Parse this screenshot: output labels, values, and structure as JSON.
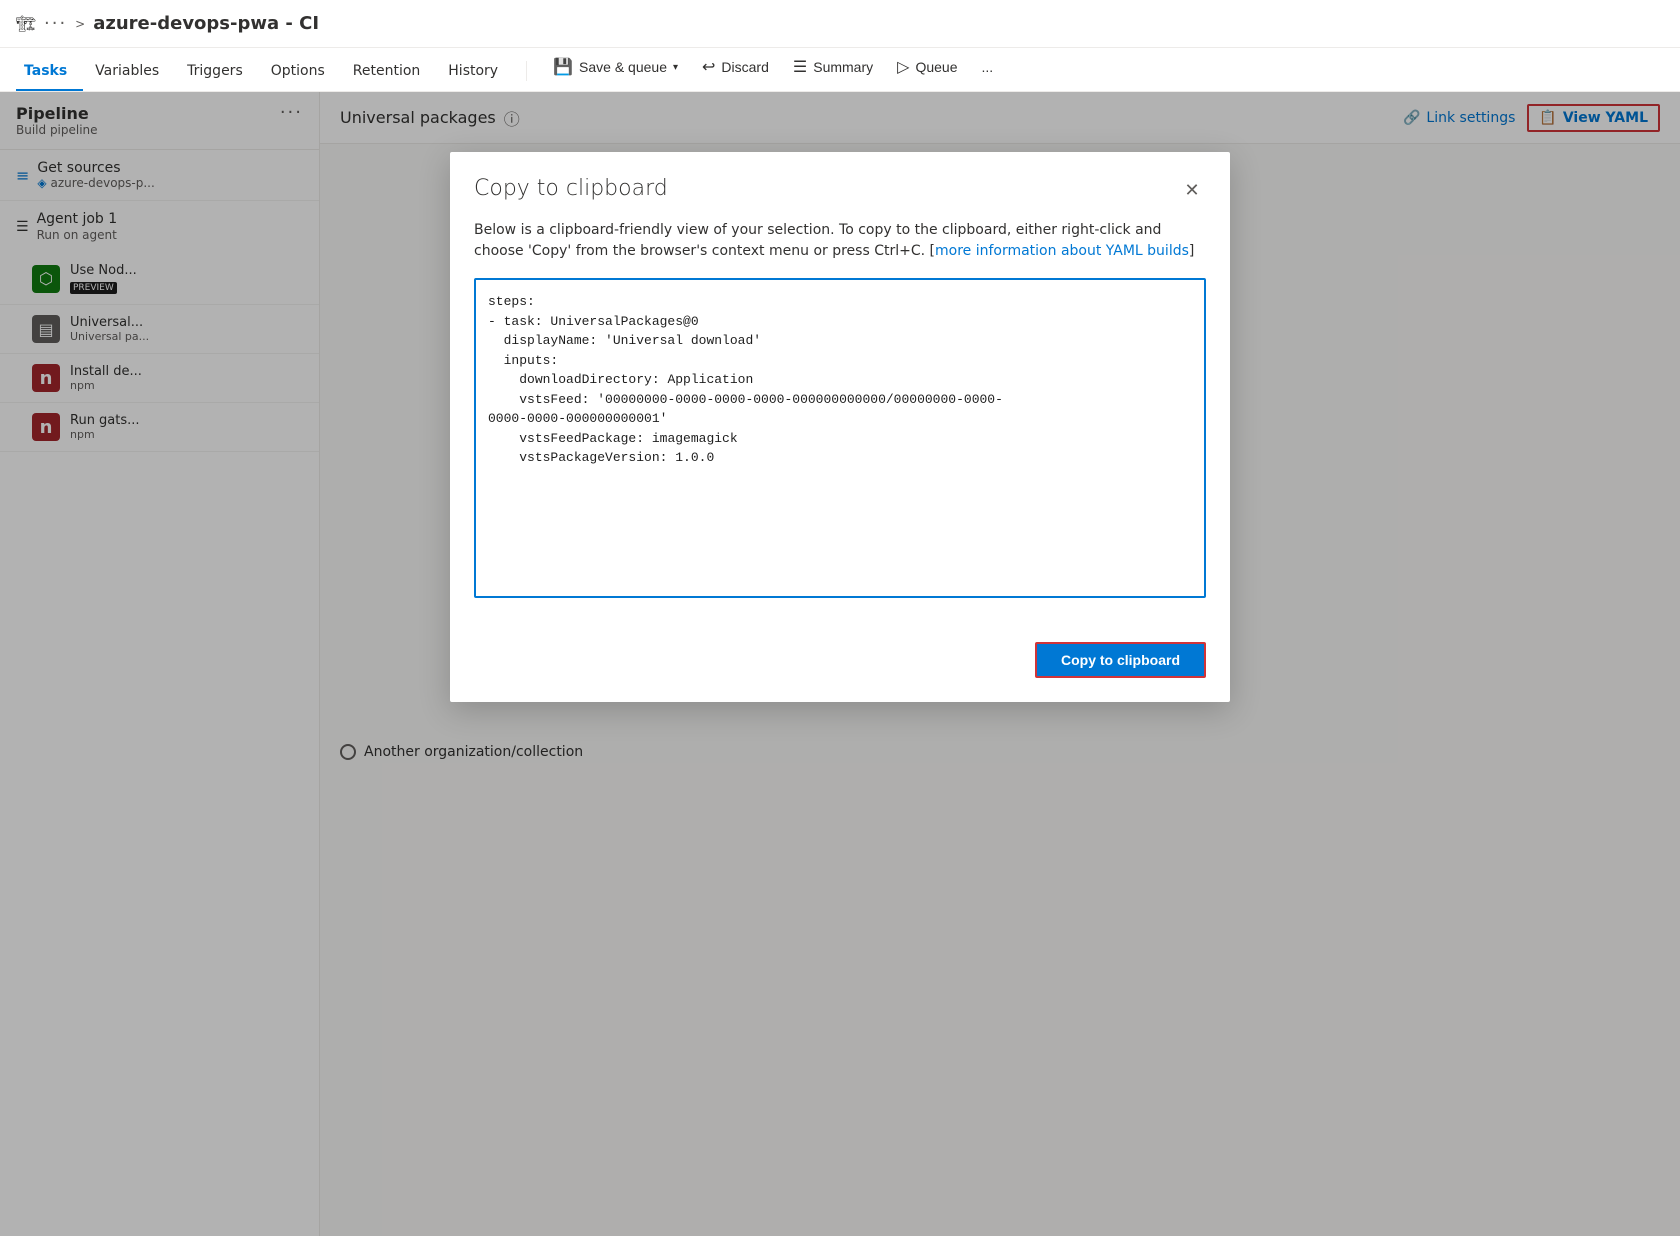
{
  "app": {
    "icon": "🏗",
    "breadcrumb_dots": "···",
    "breadcrumb_sep": ">",
    "page_title": "azure-devops-pwa - CI"
  },
  "nav": {
    "tabs": [
      {
        "label": "Tasks",
        "active": true
      },
      {
        "label": "Variables",
        "active": false
      },
      {
        "label": "Triggers",
        "active": false
      },
      {
        "label": "Options",
        "active": false
      },
      {
        "label": "Retention",
        "active": false
      },
      {
        "label": "History",
        "active": false
      }
    ],
    "actions": {
      "save_queue": "Save & queue",
      "discard": "Discard",
      "summary": "Summary",
      "queue": "Queue",
      "more": "..."
    }
  },
  "left_panel": {
    "pipeline_label": "Pipeline",
    "pipeline_sub": "Build pipeline",
    "three_dots": "···",
    "get_sources_label": "Get sources",
    "get_sources_sub": "azure-devops-p...",
    "agent_job_label": "Agent job 1",
    "agent_job_sub": "Run on agent",
    "tasks": [
      {
        "id": "use-node",
        "label": "Use Nod...",
        "sub": "",
        "icon_type": "green",
        "icon_text": "⬡",
        "has_preview": true,
        "preview_label": "PREVIEW"
      },
      {
        "id": "universal",
        "label": "Universal...",
        "sub": "Universal pa...",
        "icon_type": "gray",
        "icon_text": "▤",
        "has_preview": false
      },
      {
        "id": "install-de",
        "label": "Install de...",
        "sub": "npm",
        "icon_type": "red",
        "icon_text": "n",
        "has_preview": false
      },
      {
        "id": "run-gats",
        "label": "Run gats...",
        "sub": "npm",
        "icon_type": "red",
        "icon_text": "n",
        "has_preview": false
      }
    ]
  },
  "right_panel": {
    "title": "Universal packages",
    "link_settings": "Link settings",
    "view_yaml": "View YAML",
    "another_org": "Another organization/collection"
  },
  "modal": {
    "title": "Copy to clipboard",
    "description_part1": "Below is a clipboard-friendly view of your selection. To copy to the clipboard, either right-click and choose 'Copy' from the browser's context menu or press Ctrl+C. [",
    "description_link": "more information about YAML builds",
    "description_part2": "]",
    "yaml_content": "steps:\n- task: UniversalPackages@0\n  displayName: 'Universal download'\n  inputs:\n    downloadDirectory: Application\n    vstsFeed: '00000000-0000-0000-0000-000000000000/00000000-0000-\n0000-0000-000000000001'\n    vstsFeedPackage: imagemagick\n    vstsPackageVersion: 1.0.0",
    "copy_btn_label": "Copy to clipboard",
    "close_icon": "✕"
  }
}
